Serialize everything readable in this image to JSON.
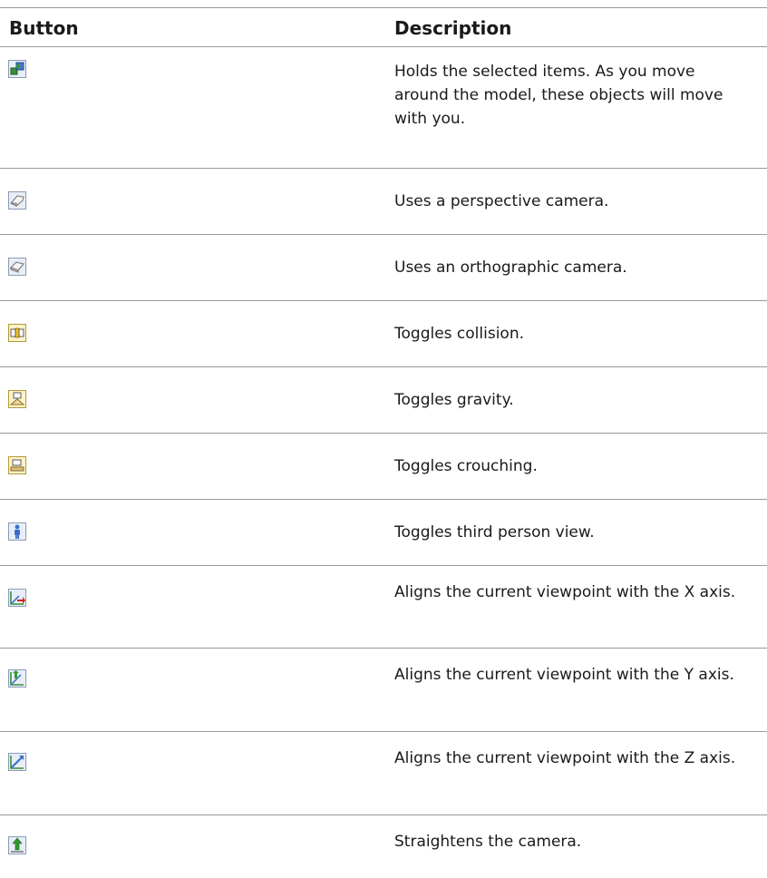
{
  "header": {
    "col_button": "Button",
    "col_description": "Description"
  },
  "rows": [
    {
      "icon": "hold-icon",
      "description": "Holds the selected items. As you move around the model, these objects will move with you."
    },
    {
      "icon": "perspective-camera-icon",
      "description": "Uses a perspective camera."
    },
    {
      "icon": "orthographic-camera-icon",
      "description": "Uses an orthographic camera."
    },
    {
      "icon": "collision-icon",
      "description": "Toggles collision."
    },
    {
      "icon": "gravity-icon",
      "description": "Toggles gravity."
    },
    {
      "icon": "crouch-icon",
      "description": "Toggles crouching."
    },
    {
      "icon": "third-person-icon",
      "description": "Toggles third person view."
    },
    {
      "icon": "align-x-icon",
      "description": "Aligns the current viewpoint with the X axis."
    },
    {
      "icon": "align-y-icon",
      "description": "Aligns the current viewpoint with the Y axis."
    },
    {
      "icon": "align-z-icon",
      "description": "Aligns the current viewpoint with the Z axis."
    },
    {
      "icon": "straighten-icon",
      "description": "Straightens the camera."
    }
  ]
}
